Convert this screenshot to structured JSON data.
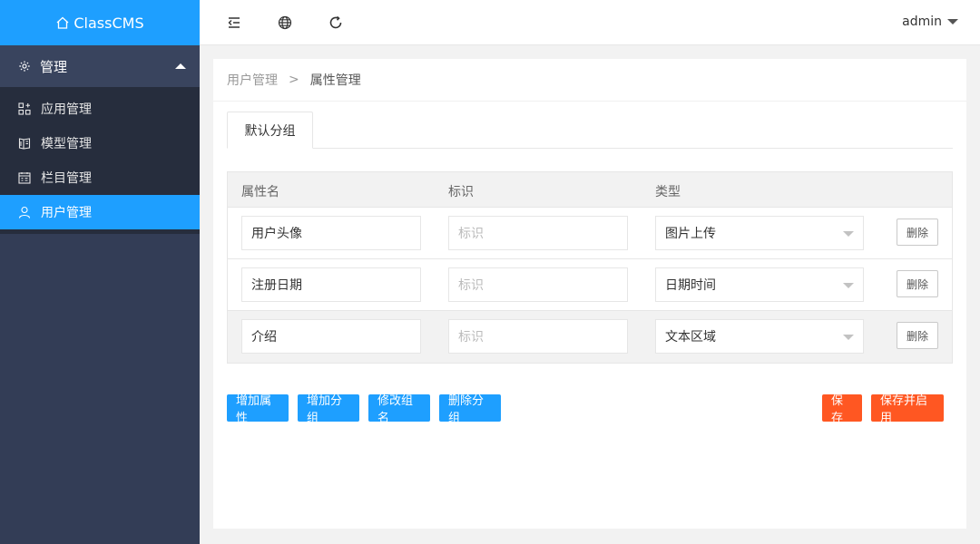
{
  "app": {
    "title": "ClassCMS"
  },
  "sidebar": {
    "group_label": "管理",
    "items": [
      {
        "label": "应用管理",
        "icon": "apps-icon"
      },
      {
        "label": "模型管理",
        "icon": "model-icon"
      },
      {
        "label": "栏目管理",
        "icon": "column-icon"
      },
      {
        "label": "用户管理",
        "icon": "user-icon",
        "active": true
      }
    ]
  },
  "header": {
    "user": "admin"
  },
  "breadcrumb": {
    "parent": "用户管理",
    "separator": ">",
    "current": "属性管理"
  },
  "tabs": [
    {
      "label": "默认分组"
    }
  ],
  "table": {
    "headers": [
      "属性名",
      "标识",
      "类型"
    ],
    "rows": [
      {
        "name": "用户头像",
        "id_placeholder": "标识",
        "type": "图片上传",
        "delete": "删除"
      },
      {
        "name": "注册日期",
        "id_placeholder": "标识",
        "type": "日期时间",
        "delete": "删除"
      },
      {
        "name": "介绍",
        "id_placeholder": "标识",
        "type": "文本区域",
        "delete": "删除"
      }
    ]
  },
  "actions": {
    "add_attr": "增加属性",
    "add_group": "增加分组",
    "rename_group": "修改组名",
    "delete_group": "删除分组",
    "save": "保存",
    "save_enable": "保存并启用"
  },
  "colors": {
    "primary": "#1e9fff",
    "danger": "#ff5722",
    "sidebar": "#333d56"
  }
}
